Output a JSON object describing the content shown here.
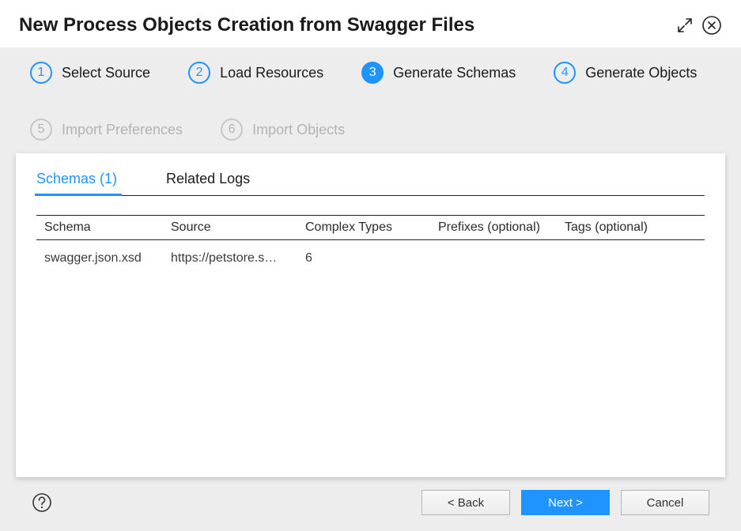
{
  "dialog": {
    "title": "New Process Objects Creation from Swagger Files"
  },
  "steps": [
    {
      "num": "1",
      "label": "Select Source",
      "state": "done"
    },
    {
      "num": "2",
      "label": "Load Resources",
      "state": "done"
    },
    {
      "num": "3",
      "label": "Generate Schemas",
      "state": "active"
    },
    {
      "num": "4",
      "label": "Generate Objects",
      "state": "done"
    },
    {
      "num": "5",
      "label": "Import Preferences",
      "state": "disabled"
    },
    {
      "num": "6",
      "label": "Import Objects",
      "state": "disabled"
    }
  ],
  "tabs": {
    "schemas": "Schemas (1)",
    "logs": "Related Logs"
  },
  "table": {
    "headers": {
      "schema": "Schema",
      "source": "Source",
      "complex": "Complex Types",
      "prefixes": "Prefixes (optional)",
      "tags": "Tags (optional)"
    },
    "rows": [
      {
        "schema": "swagger.json.xsd",
        "source": "https://petstore.s…",
        "complex": "6",
        "prefixes": "",
        "tags": ""
      }
    ]
  },
  "buttons": {
    "back": "< Back",
    "next": "Next >",
    "cancel": "Cancel"
  }
}
